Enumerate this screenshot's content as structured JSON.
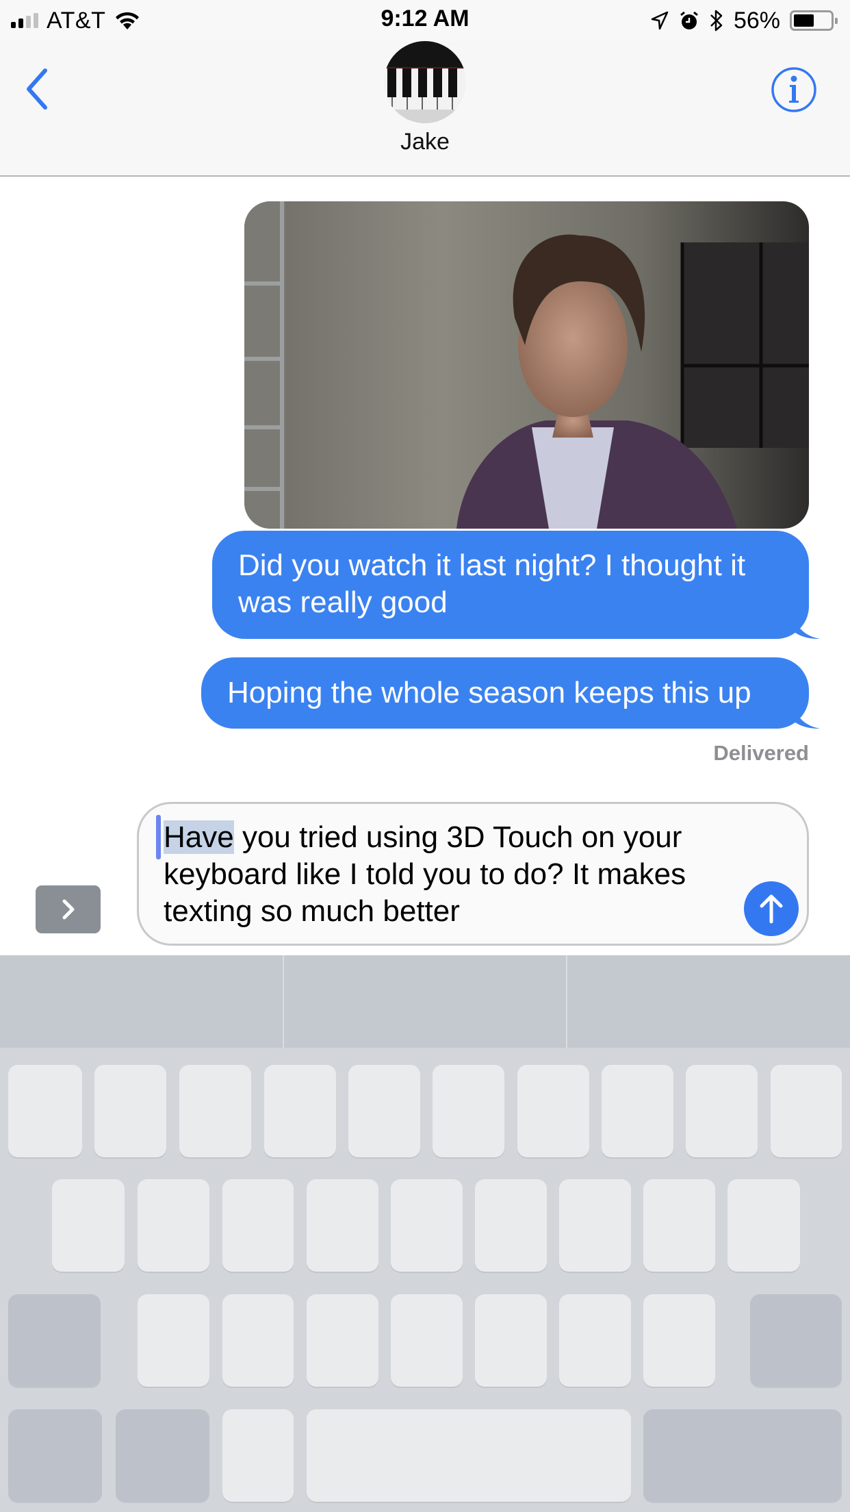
{
  "status_bar": {
    "carrier": "AT&T",
    "signal_bars_active": 2,
    "signal_bars_total": 4,
    "time": "9:12 AM",
    "battery_percent": "56%",
    "battery_level": 0.56,
    "icons": [
      "signal-icon",
      "wifi-icon",
      "location-arrow-icon",
      "alarm-icon",
      "bluetooth-icon",
      "battery-icon"
    ]
  },
  "nav": {
    "back_icon": "chevron-left-icon",
    "contact_name": "Jake",
    "avatar": "piano-keys-avatar",
    "info_icon": "info-circle-icon"
  },
  "conversation": {
    "messages": [
      {
        "type": "image",
        "sender": "me",
        "description": "GIF of man in purple hoodie"
      },
      {
        "type": "text",
        "sender": "me",
        "text": "Did you watch it last night? I thought it was really good"
      },
      {
        "type": "text",
        "sender": "me",
        "text": "Hoping the whole season keeps this up"
      }
    ],
    "status": "Delivered"
  },
  "composer": {
    "selected_word": "Have",
    "text_rest": " you tried using 3D Touch on your keyboard like I told you to do? It makes texting so much better",
    "expand_icon": "chevron-right-icon",
    "send_icon": "arrow-up-icon"
  },
  "colors": {
    "accent": "#3b82f1",
    "nav_tint": "#3478f1",
    "delivered": "#8e8e93",
    "keyboard_bg": "#d2d5d9",
    "key": "#eaebed",
    "key_dark": "#bdc2ca"
  },
  "keyboard": {
    "mode": "trackpad-3d-touch",
    "prediction_slots": 3,
    "rows": [
      10,
      9,
      9,
      5
    ]
  }
}
